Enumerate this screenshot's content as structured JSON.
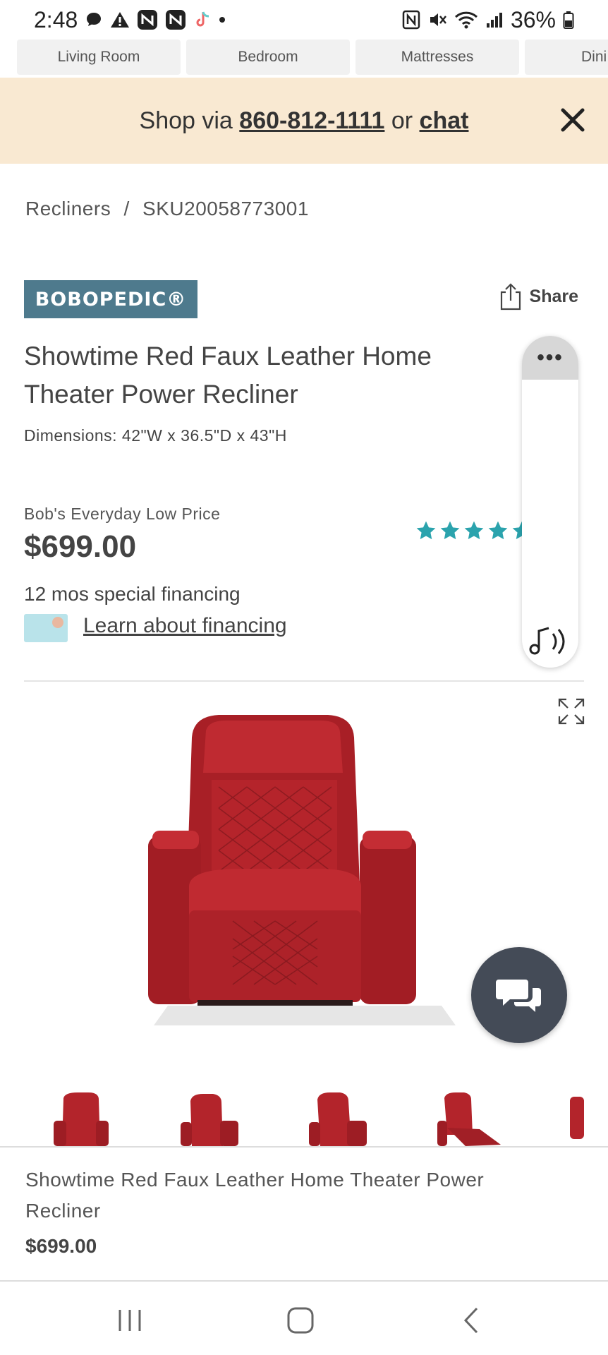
{
  "status_bar": {
    "time": "2:48",
    "battery": "36%"
  },
  "categories": [
    "Living Room",
    "Bedroom",
    "Mattresses",
    "Dini"
  ],
  "promo": {
    "prefix": "Shop via ",
    "phone": "860-812-1111",
    "middle": " or ",
    "chat": "chat"
  },
  "breadcrumb": {
    "category": "Recliners",
    "separator": "/",
    "sku": "SKU20058773001"
  },
  "brand": {
    "logo_text": "BOBOPEDIC®"
  },
  "share_label": "Share",
  "product": {
    "title": "Showtime Red Faux Leather Home Theater Power Recliner",
    "dimensions": "Dimensions: 42\"W x 36.5\"D x 43\"H",
    "price_label": "Bob's Everyday Low Price",
    "price": "$699.00",
    "rating_stars": 5,
    "rating_count_visible": ")."
  },
  "financing": {
    "headline": "12 mos special financing",
    "link": "Learn about financing"
  },
  "side_widget": {
    "menu_label": "•••"
  },
  "sticky": {
    "title": "Showtime Red Faux Leather Home Theater Power Recliner",
    "price": "$699.00"
  },
  "colors": {
    "promo_bg": "#f9e9d2",
    "brand_bg": "#4e7a8d",
    "star": "#2ba3ad",
    "chair_red": "#b8242a",
    "chat_bg": "#444b57"
  }
}
